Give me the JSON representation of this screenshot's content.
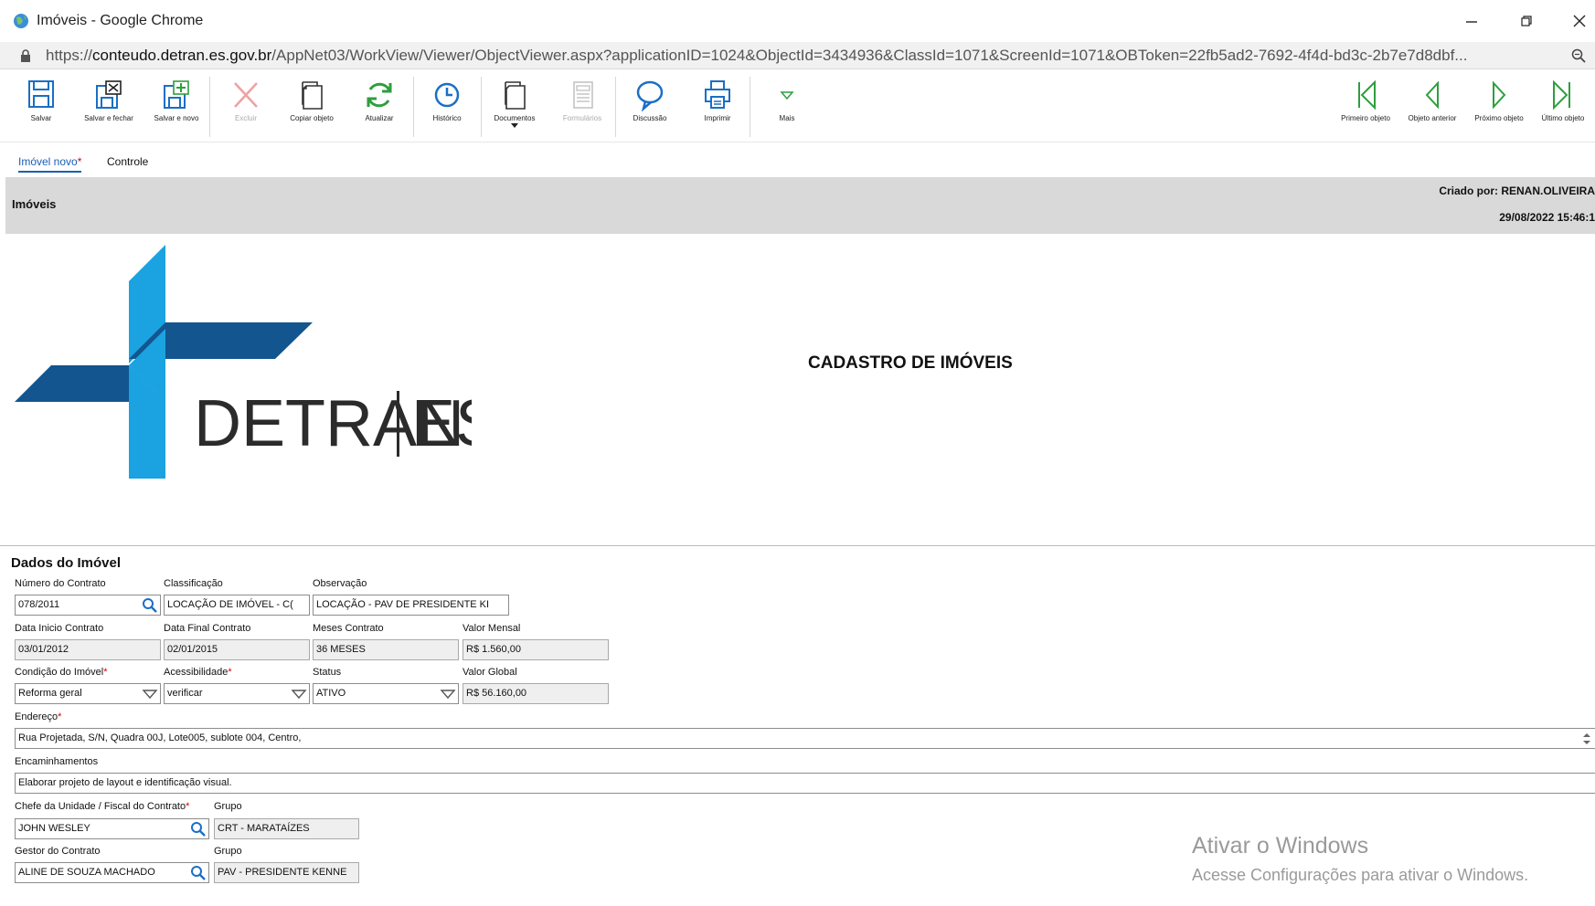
{
  "window": {
    "title": "Imóveis - Google Chrome",
    "url_prefix": "https://",
    "url_domain": "conteudo.detran.es.gov.br",
    "url_path": "/AppNet03/WorkView/Viewer/ObjectViewer.aspx?applicationID=1024&ObjectId=3434936&ClassId=1071&ScreenId=1071&OBToken=22fb5ad2-7692-4f4d-bd3c-2b7e7d8dbf..."
  },
  "toolbar": {
    "salvar": "Salvar",
    "salvar_fechar": "Salvar e fechar",
    "salvar_novo": "Salvar e novo",
    "excluir": "Excluir",
    "copiar": "Copiar objeto",
    "atualizar": "Atualizar",
    "historico": "Histórico",
    "documentos": "Documentos",
    "formularios": "Formulários",
    "discussao": "Discussão",
    "imprimir": "Imprimir",
    "mais": "Mais",
    "primeiro": "Primeiro objeto",
    "anterior": "Objeto anterior",
    "proximo": "Próximo objeto",
    "ultimo": "Último objeto"
  },
  "tabs": {
    "imovel_novo": "Imóvel novo",
    "controle": "Controle"
  },
  "header": {
    "section": "Imóveis",
    "created_by": "Criado por: RENAN.OLIVEIRA",
    "created_at": "29/08/2022 15:46:1"
  },
  "logo": {
    "word1": "DETRAN",
    "word2": "ES"
  },
  "page_title": "CADASTRO DE IMÓVEIS",
  "form": {
    "title": "Dados do Imóvel",
    "numero_contrato": {
      "label": "Número do Contrato",
      "value": "078/2011"
    },
    "classificacao": {
      "label": "Classificação",
      "value": "LOCAÇÃO DE IMÓVEL - C("
    },
    "observacao": {
      "label": "Observação",
      "value": "LOCAÇÃO - PAV DE PRESIDENTE KI"
    },
    "data_inicio": {
      "label": "Data Inicio Contrato",
      "value": "03/01/2012"
    },
    "data_final": {
      "label": "Data Final Contrato",
      "value": "02/01/2015"
    },
    "meses": {
      "label": "Meses Contrato",
      "value": "36 MESES"
    },
    "valor_mensal": {
      "label": "Valor Mensal",
      "value": "R$ 1.560,00"
    },
    "condicao": {
      "label": "Condição do Imóvel",
      "value": "Reforma geral"
    },
    "acessibilidade": {
      "label": "Acessibilidade",
      "value": "verificar"
    },
    "status": {
      "label": "Status",
      "value": "ATIVO"
    },
    "valor_global": {
      "label": "Valor Global",
      "value": "R$ 56.160,00"
    },
    "endereco": {
      "label": "Endereço",
      "value": "Rua Projetada, S/N, Quadra 00J, Lote005, sublote 004, Centro,"
    },
    "encaminhamentos": {
      "label": "Encaminhamentos",
      "value": "Elaborar projeto de layout e identificação visual."
    },
    "chefe": {
      "label": "Chefe da Unidade / Fiscal do Contrato",
      "value": "JOHN WESLEY"
    },
    "grupo1": {
      "label": "Grupo",
      "value": "CRT - MARATAÍZES"
    },
    "gestor": {
      "label": "Gestor do Contrato",
      "value": "ALINE DE SOUZA MACHADO"
    },
    "grupo2": {
      "label": "Grupo",
      "value": "PAV - PRESIDENTE KENNE"
    },
    "required_mark": "*"
  },
  "watermark": {
    "line1": "Ativar o Windows",
    "line2": "Acesse Configurações para ativar o Windows."
  },
  "colors": {
    "link_blue": "#1a5fb4",
    "logo_light": "#1aa3e0",
    "logo_dark": "#12558f",
    "header_gray": "#d9d9d9"
  }
}
